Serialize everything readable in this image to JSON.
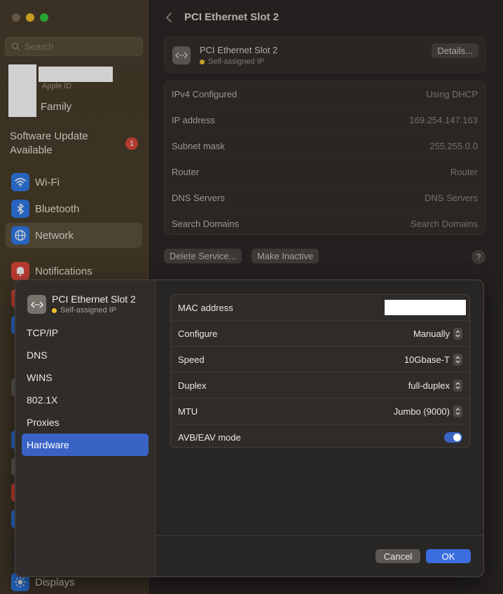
{
  "sidebar": {
    "search_placeholder": "Search",
    "apple_id_label": "Apple ID",
    "family_label": "Family",
    "software_update_label": "Software Update Available",
    "software_update_badge": "1",
    "items": [
      {
        "label": "Wi-Fi",
        "icon": "wifi-icon"
      },
      {
        "label": "Bluetooth",
        "icon": "bluetooth-icon"
      },
      {
        "label": "Network",
        "icon": "globe-icon",
        "active": true
      },
      {
        "label": "Notifications",
        "icon": "bell-icon"
      },
      {
        "label": "Displays",
        "icon": "sun-icon"
      }
    ]
  },
  "main": {
    "title": "PCI Ethernet Slot 2",
    "service": {
      "name": "PCI Ethernet Slot 2",
      "status": "Self-assigned IP",
      "details_label": "Details..."
    },
    "info_rows": [
      {
        "label": "IPv4 Configured",
        "value": "Using DHCP"
      },
      {
        "label": "IP address",
        "value": "169.254.147.163"
      },
      {
        "label": "Subnet mask",
        "value": "255.255.0.0"
      },
      {
        "label": "Router",
        "value": "Router"
      },
      {
        "label": "DNS Servers",
        "value": "DNS Servers"
      },
      {
        "label": "Search Domains",
        "value": "Search Domains"
      }
    ],
    "delete_service_label": "Delete Service...",
    "make_inactive_label": "Make Inactive",
    "help_label": "?"
  },
  "sheet": {
    "title": "PCI Ethernet Slot 2",
    "status": "Self-assigned IP",
    "nav": [
      "TCP/IP",
      "DNS",
      "WINS",
      "802.1X",
      "Proxies",
      "Hardware"
    ],
    "active_nav": "Hardware",
    "hardware_rows": {
      "mac_label": "MAC address",
      "configure_label": "Configure",
      "configure_value": "Manually",
      "speed_label": "Speed",
      "speed_value": "10Gbase-T",
      "duplex_label": "Duplex",
      "duplex_value": "full-duplex",
      "mtu_label": "MTU",
      "mtu_value": "Jumbo (9000)",
      "avb_label": "AVB/EAV mode",
      "avb_enabled": true
    },
    "cancel_label": "Cancel",
    "ok_label": "OK"
  },
  "colors": {
    "accent": "#3a63c6",
    "status_yellow": "#f2c230",
    "badge_red": "#d9463b"
  }
}
